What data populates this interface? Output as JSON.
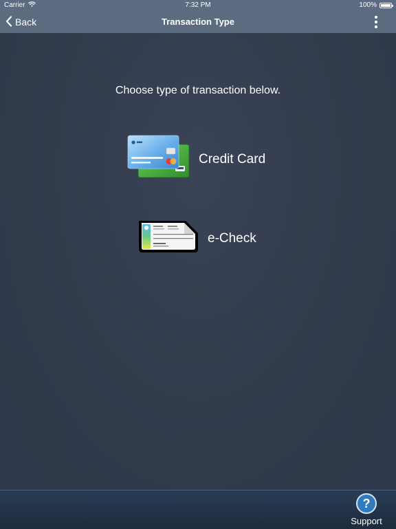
{
  "status_bar": {
    "carrier": "Carrier",
    "time": "7:32 PM",
    "battery": "100%",
    "battery_level": 1.0
  },
  "nav_bar": {
    "back_label": "Back",
    "title": "Transaction Type",
    "back_icon": "chevron-left-icon",
    "more_icon": "vertical-ellipsis-icon"
  },
  "main": {
    "instruction": "Choose type of transaction below.",
    "options": [
      {
        "label": "Credit Card",
        "icon": "credit-card-icon"
      },
      {
        "label": "e-Check",
        "icon": "check-icon"
      }
    ]
  },
  "bottom_bar": {
    "support_label": "Support",
    "support_icon": "question-mark-icon",
    "support_symbol": "?"
  },
  "colors": {
    "nav_bar": "#5d6b80",
    "background": "#2f3a4c",
    "support_button": "#2f7bbd"
  }
}
